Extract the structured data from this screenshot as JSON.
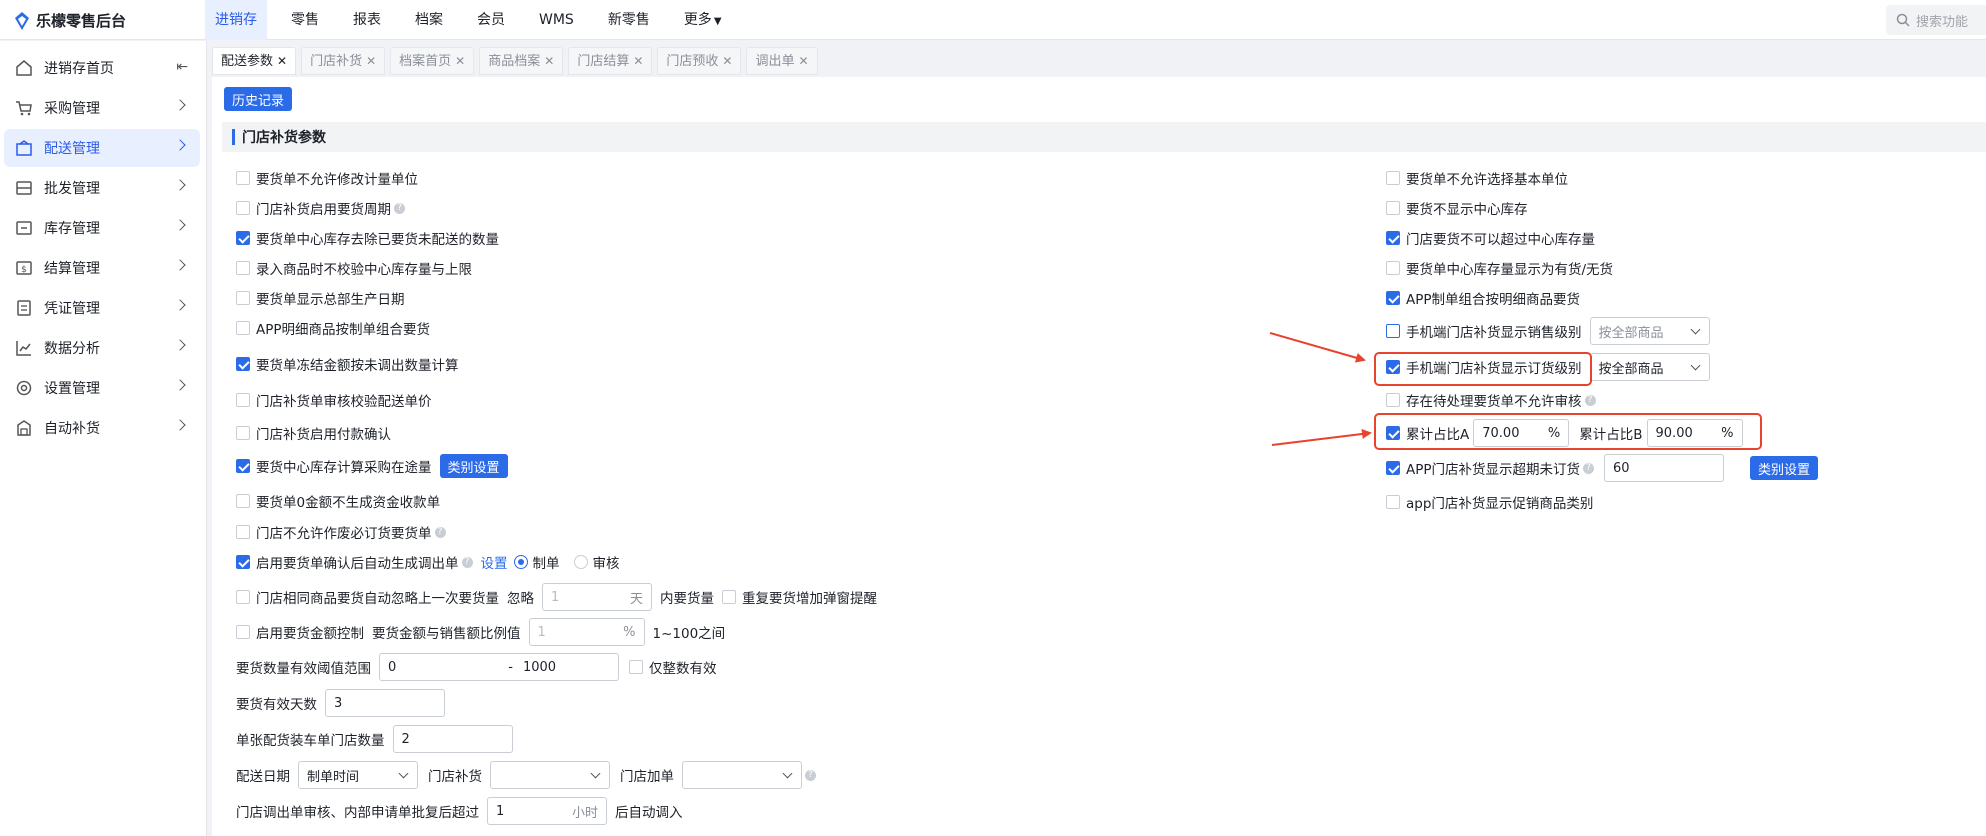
{
  "app": {
    "title": "乐檬零售后台"
  },
  "topnav": {
    "items": [
      "进销存",
      "零售",
      "报表",
      "档案",
      "会员",
      "WMS",
      "新零售",
      "更多"
    ],
    "search_placeholder": "搜索功能"
  },
  "sidebar": {
    "items": [
      "进销存首页",
      "采购管理",
      "配送管理",
      "批发管理",
      "库存管理",
      "结算管理",
      "凭证管理",
      "数据分析",
      "设置管理",
      "自动补货"
    ]
  },
  "tabs": [
    "配送参数",
    "门店补货",
    "档案首页",
    "商品档案",
    "门店结算",
    "门店预收",
    "调出单"
  ],
  "content": {
    "history_button": "历史记录",
    "section_title": "门店补货参数",
    "left": {
      "opt1": "要货单不允许修改计量单位",
      "opt2": "门店补货启用要货周期",
      "opt3": "要货单中心库存去除已要货未配送的数量",
      "opt4": "录入商品时不校验中心库存量与上限",
      "opt5": "要货单显示总部生产日期",
      "opt6": "APP明细商品按制单组合要货",
      "opt7": "要货单冻结金额按未调出数量计算",
      "opt8": "门店补货单审核校验配送单价",
      "opt9": "门店补货启用付款确认",
      "opt10": "要货中心库存计算采购在途量",
      "opt10_button": "类别设置",
      "opt11": "要货单0金额不生成资金收款单",
      "opt12": "门店不允许作废必订货要货单",
      "opt13": "启用要货单确认后自动生成调出单",
      "opt13_link": "设置",
      "opt13_radio1": "制单",
      "opt13_radio2": "审核",
      "opt14": "门店相同商品要货自动忽略上一次要货量",
      "opt14_ignore": "忽略",
      "opt14_days_placeholder": "1",
      "opt14_days_unit": "天",
      "opt14_after": "内要货量",
      "opt14_extra": "重复要货增加弹窗提醒",
      "opt15": "启用要货金额控制",
      "opt15_label": "要货金额与销售额比例值",
      "opt15_value": "1",
      "opt15_unit": "%",
      "opt15_range": "1~100之间",
      "threshold_label": "要货数量有效阈值范围",
      "threshold_min": "0",
      "threshold_sep": "-",
      "threshold_max": "1000",
      "threshold_integer": "仅整数有效",
      "valid_days_label": "要货有效天数",
      "valid_days_value": "3",
      "truck_label": "单张配货装车单门店数量",
      "truck_value": "2",
      "delivery_date_label": "配送日期",
      "delivery_date_value": "制单时间",
      "store_replenish_label": "门店补货",
      "store_replenish_value": "",
      "store_add_label": "门店加单",
      "store_add_value": "",
      "auto_in_label": "门店调出单审核、内部申请单批复后超过",
      "auto_in_value": "1",
      "auto_in_unit": "小时",
      "auto_in_after": "后自动调入"
    },
    "right": {
      "opt1": "要货单不允许选择基本单位",
      "opt2": "要货不显示中心库存",
      "opt3": "门店要货不可以超过中心库存量",
      "opt4": "要货单中心库存量显示为有货/无货",
      "opt5": "APP制单组合按明细商品要货",
      "opt6": "手机端门店补货显示销售级别",
      "opt6_select": "按全部商品",
      "opt7": "手机端门店补货显示订货级别",
      "opt7_select": "按全部商品",
      "opt8": "存在待处理要货单不允许审核",
      "opt9_a_label": "累计占比A",
      "opt9_a_value": "70.00",
      "opt9_b_label": "累计占比B",
      "opt9_b_value": "90.00",
      "opt9_unit": "%",
      "opt10": "APP门店补货显示超期未订货",
      "opt10_value": "60",
      "opt10_button": "类别设置",
      "opt11": "app门店补货显示促销商品类别"
    }
  },
  "colors": {
    "accent": "#2c6be8",
    "highlight": "#e8432e"
  }
}
